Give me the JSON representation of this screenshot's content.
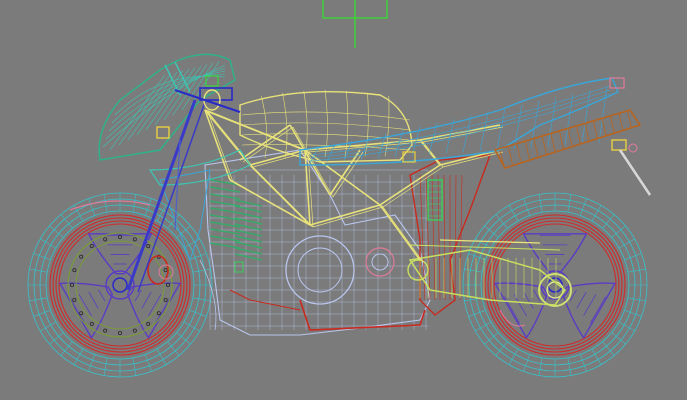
{
  "viewport": {
    "kind": "3d-wireframe-viewport",
    "background": "#7b7b7b",
    "subject": "motorcycle-wireframe"
  },
  "colors": {
    "gizmo": "#2ee62e",
    "fairing": "#3ec6b4",
    "fairing_front": "#2fb28a",
    "tank": "#e8e27a",
    "frame": "#e8e27a",
    "tail": "#3aa6d8",
    "exhaust": "#b8641e",
    "engine": "#b9c6ee",
    "wheel_rim": "#d12a2a",
    "wheel_outer": "#34c4cc",
    "hub_spokes": "#5a3cc4",
    "swingarm": "#c8e060",
    "red_parts": "#c92a1e",
    "chain_guard": "#7a9a3a",
    "pink": "#e07b9a"
  },
  "icons": [
    "axis-gizmo-icon"
  ]
}
